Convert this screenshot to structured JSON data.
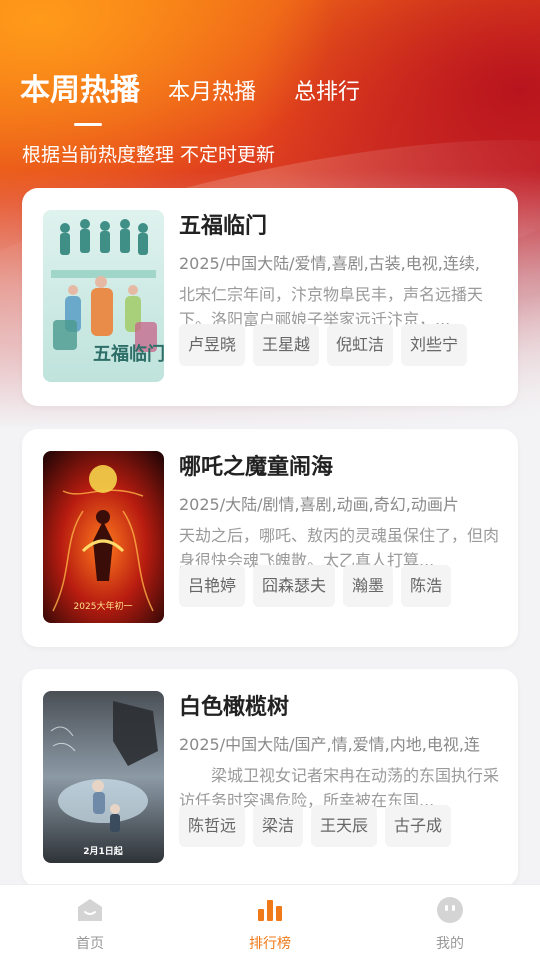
{
  "tabs": {
    "weekly": "本周热播",
    "monthly": "本月热播",
    "overall": "总排行"
  },
  "subtitle": "根据当前热度整理 不定时更新",
  "colors": {
    "accent": "#f07a1a",
    "card_bg": "#ffffff",
    "tag_bg": "#f4f4f4"
  },
  "cards": [
    {
      "title": "五福临门",
      "meta": "2025/中国大陆/爱情,喜剧,古装,电视,连续,",
      "desc": "北宋仁宗年间，汴京物阜民丰，声名远播天下。洛阳富户郦娘子举家远迁汴京，...",
      "actors": [
        "卢昱晓",
        "王星越",
        "倪虹洁",
        "刘些宁"
      ]
    },
    {
      "title": "哪吒之魔童闹海",
      "meta": "2025/大陆/剧情,喜剧,动画,奇幻,动画片",
      "desc": "天劫之后，哪吒、敖丙的灵魂虽保住了，但肉身很快会魂飞魄散。太乙真人打算...",
      "actors": [
        "吕艳婷",
        "囧森瑟夫",
        "瀚墨",
        "陈浩"
      ]
    },
    {
      "title": "白色橄榄树",
      "meta": "2025/中国大陆/国产,情,爱情,内地,电视,连",
      "desc": "　　梁城卫视女记者宋冉在动荡的东国执行采访任务时突遇危险，所幸被在东国...",
      "actors": [
        "陈哲远",
        "梁洁",
        "王天辰",
        "古子成"
      ]
    }
  ],
  "posters": {
    "card1_text": "五福临门",
    "card2_text": "2025大年初一",
    "card3_text": "2月1日起"
  },
  "nav": {
    "home": "首页",
    "ranking": "排行榜",
    "mine": "我的"
  }
}
